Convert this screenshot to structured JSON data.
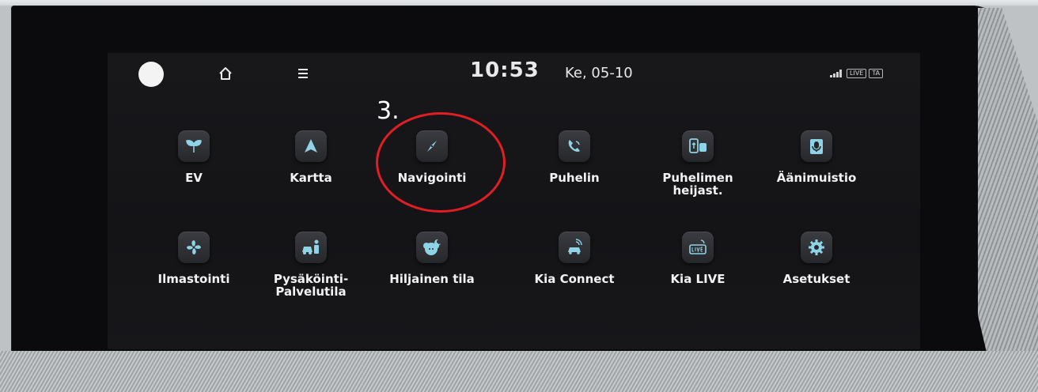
{
  "status_bar": {
    "time": "10:53",
    "date": "Ke, 05-10",
    "indicator_live": "LIVE",
    "indicator_ta": "TA"
  },
  "apps_row1": [
    {
      "label": "EV",
      "icon": "leaf-icon"
    },
    {
      "label": "Kartta",
      "icon": "map-arrow-icon"
    },
    {
      "label": "Navigointi",
      "icon": "compass-icon"
    },
    {
      "label": "Puhelin",
      "icon": "phone-icon"
    },
    {
      "label": "Puhelimen heijast.",
      "icon": "phone-projection-icon"
    },
    {
      "label": "Äänimuistio",
      "icon": "voice-memo-icon"
    }
  ],
  "apps_row2": [
    {
      "label": "Ilmastointi",
      "icon": "fan-icon"
    },
    {
      "label": "Pysäköinti-Palvelutila",
      "icon": "parking-service-icon"
    },
    {
      "label": "Hiljainen tila",
      "icon": "quiet-mode-icon"
    },
    {
      "label": "Kia Connect",
      "icon": "connected-car-icon"
    },
    {
      "label": "Kia LIVE",
      "icon": "live-icon"
    },
    {
      "label": "Asetukset",
      "icon": "gear-icon"
    }
  ],
  "annotation": {
    "number": "3.",
    "highlight_color": "#e01e24"
  }
}
